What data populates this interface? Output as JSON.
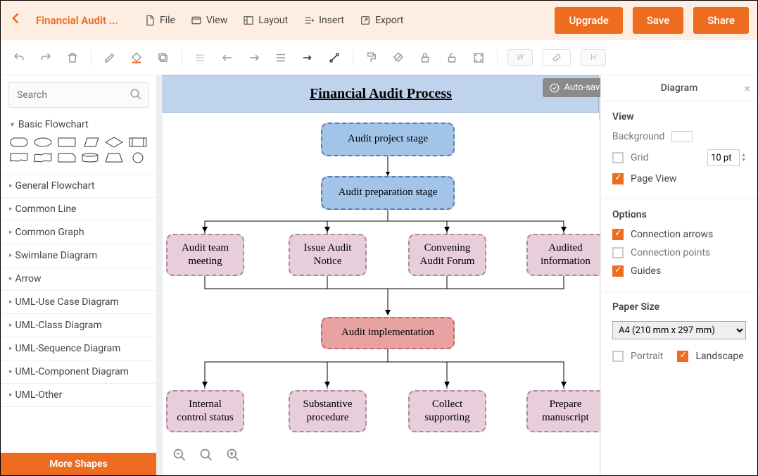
{
  "header": {
    "doc_title": "Financial Audit ...",
    "menu": {
      "file": "File",
      "view": "View",
      "layout": "Layout",
      "insert": "Insert",
      "export": "Export"
    },
    "buttons": {
      "upgrade": "Upgrade",
      "save": "Save",
      "share": "Share"
    }
  },
  "search": {
    "placeholder": "Search"
  },
  "shape_section_title": "Basic Flowchart",
  "categories": [
    "General Flowchart",
    "Common Line",
    "Common Graph",
    "Swimlane Diagram",
    "Arrow",
    "UML-Use Case Diagram",
    "UML-Class Diagram",
    "UML-Sequence Diagram",
    "UML-Component Diagram",
    "UML-Other"
  ],
  "more_shapes": "More Shapes",
  "autosave": "Auto-save",
  "canvas": {
    "title": "Financial Audit Process",
    "nodes": {
      "n1": "Audit project stage",
      "n2": "Audit preparation stage",
      "n3": "Audit team meeting",
      "n4": "Issue Audit Notice",
      "n5": "Convening Audit Forum",
      "n6": "Audited information",
      "n7": "Audit implementation",
      "n8": "Internal control status",
      "n9": "Substantive procedure",
      "n10": "Collect supporting",
      "n11": "Prepare manuscript"
    }
  },
  "panel": {
    "title": "Diagram",
    "view": {
      "title": "View",
      "background": "Background",
      "grid": "Grid",
      "grid_value": "10 pt",
      "page_view": "Page View"
    },
    "options": {
      "title": "Options",
      "conn_arrows": "Connection arrows",
      "conn_points": "Connection points",
      "guides": "Guides"
    },
    "paper": {
      "title": "Paper Size",
      "value": "A4 (210 mm x 297 mm)",
      "portrait": "Portrait",
      "landscape": "Landscape"
    }
  }
}
